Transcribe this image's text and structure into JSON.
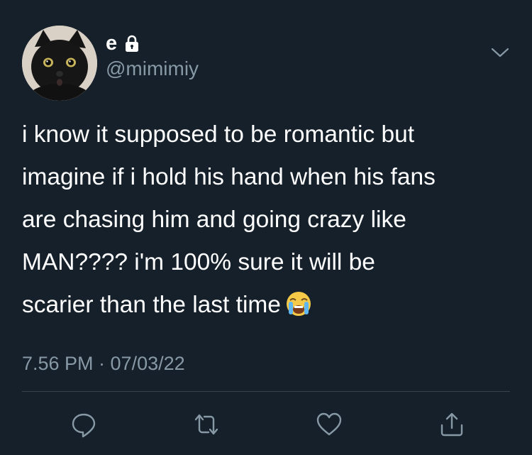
{
  "user": {
    "display_name": "e",
    "handle": "@mimimiy",
    "avatar_icon": "black-cat-avatar",
    "protected_icon": "lock-icon"
  },
  "tweet": {
    "lines": [
      "i know it supposed to be romantic but",
      "imagine if i hold his hand when his fans",
      "are chasing him and going crazy like",
      "MAN???? i'm 100% sure it will be",
      "scarier than the last time"
    ],
    "emoji": "loudly-crying-face-emoji",
    "timestamp": "7.56 PM · 07/03/22"
  },
  "actions": [
    {
      "name": "reply",
      "icon": "reply-icon"
    },
    {
      "name": "retweet",
      "icon": "retweet-icon"
    },
    {
      "name": "like",
      "icon": "heart-icon"
    },
    {
      "name": "share",
      "icon": "share-icon"
    }
  ],
  "colors": {
    "background": "#15202b",
    "text": "#ffffff",
    "secondary": "#8899a6",
    "divider": "#38444d"
  }
}
